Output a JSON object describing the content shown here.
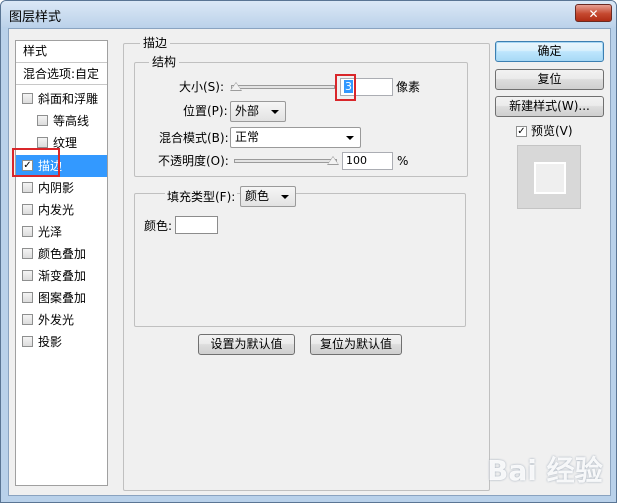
{
  "window": {
    "title": "图层样式",
    "close_glyph": "✕"
  },
  "style_list": {
    "header": "样式",
    "blend_options": "混合选项:自定",
    "items": [
      {
        "label": "斜面和浮雕",
        "checked": false
      },
      {
        "label": "等高线",
        "checked": false
      },
      {
        "label": "纹理",
        "checked": false
      },
      {
        "label": "描边",
        "checked": true
      },
      {
        "label": "内阴影",
        "checked": false
      },
      {
        "label": "内发光",
        "checked": false
      },
      {
        "label": "光泽",
        "checked": false
      },
      {
        "label": "颜色叠加",
        "checked": false
      },
      {
        "label": "渐变叠加",
        "checked": false
      },
      {
        "label": "图案叠加",
        "checked": false
      },
      {
        "label": "外发光",
        "checked": false
      },
      {
        "label": "投影",
        "checked": false
      }
    ]
  },
  "stroke": {
    "group_title": "描边",
    "structure": {
      "title": "结构",
      "size_label": "大小(S):",
      "size_value": "3",
      "size_unit": "像素",
      "position_label": "位置(P):",
      "position_value": "外部",
      "blend_mode_label": "混合模式(B):",
      "blend_mode_value": "正常",
      "opacity_label": "不透明度(O):",
      "opacity_value": "100",
      "opacity_unit": "%"
    },
    "fill": {
      "fill_type_label": "填充类型(F):",
      "fill_type_value": "颜色",
      "color_label": "颜色:",
      "color_value": "#ffffff"
    },
    "set_default_label": "设置为默认值",
    "reset_default_label": "复位为默认值"
  },
  "buttons": {
    "ok": "确定",
    "reset": "复位",
    "new_style": "新建样式(W)...",
    "preview_label": "预览(V)",
    "preview_checked": true
  },
  "check_glyph": "✓",
  "watermark": "Bai 经验",
  "colors": {
    "selection": "#3399ff",
    "highlight_box": "#d9262a"
  }
}
